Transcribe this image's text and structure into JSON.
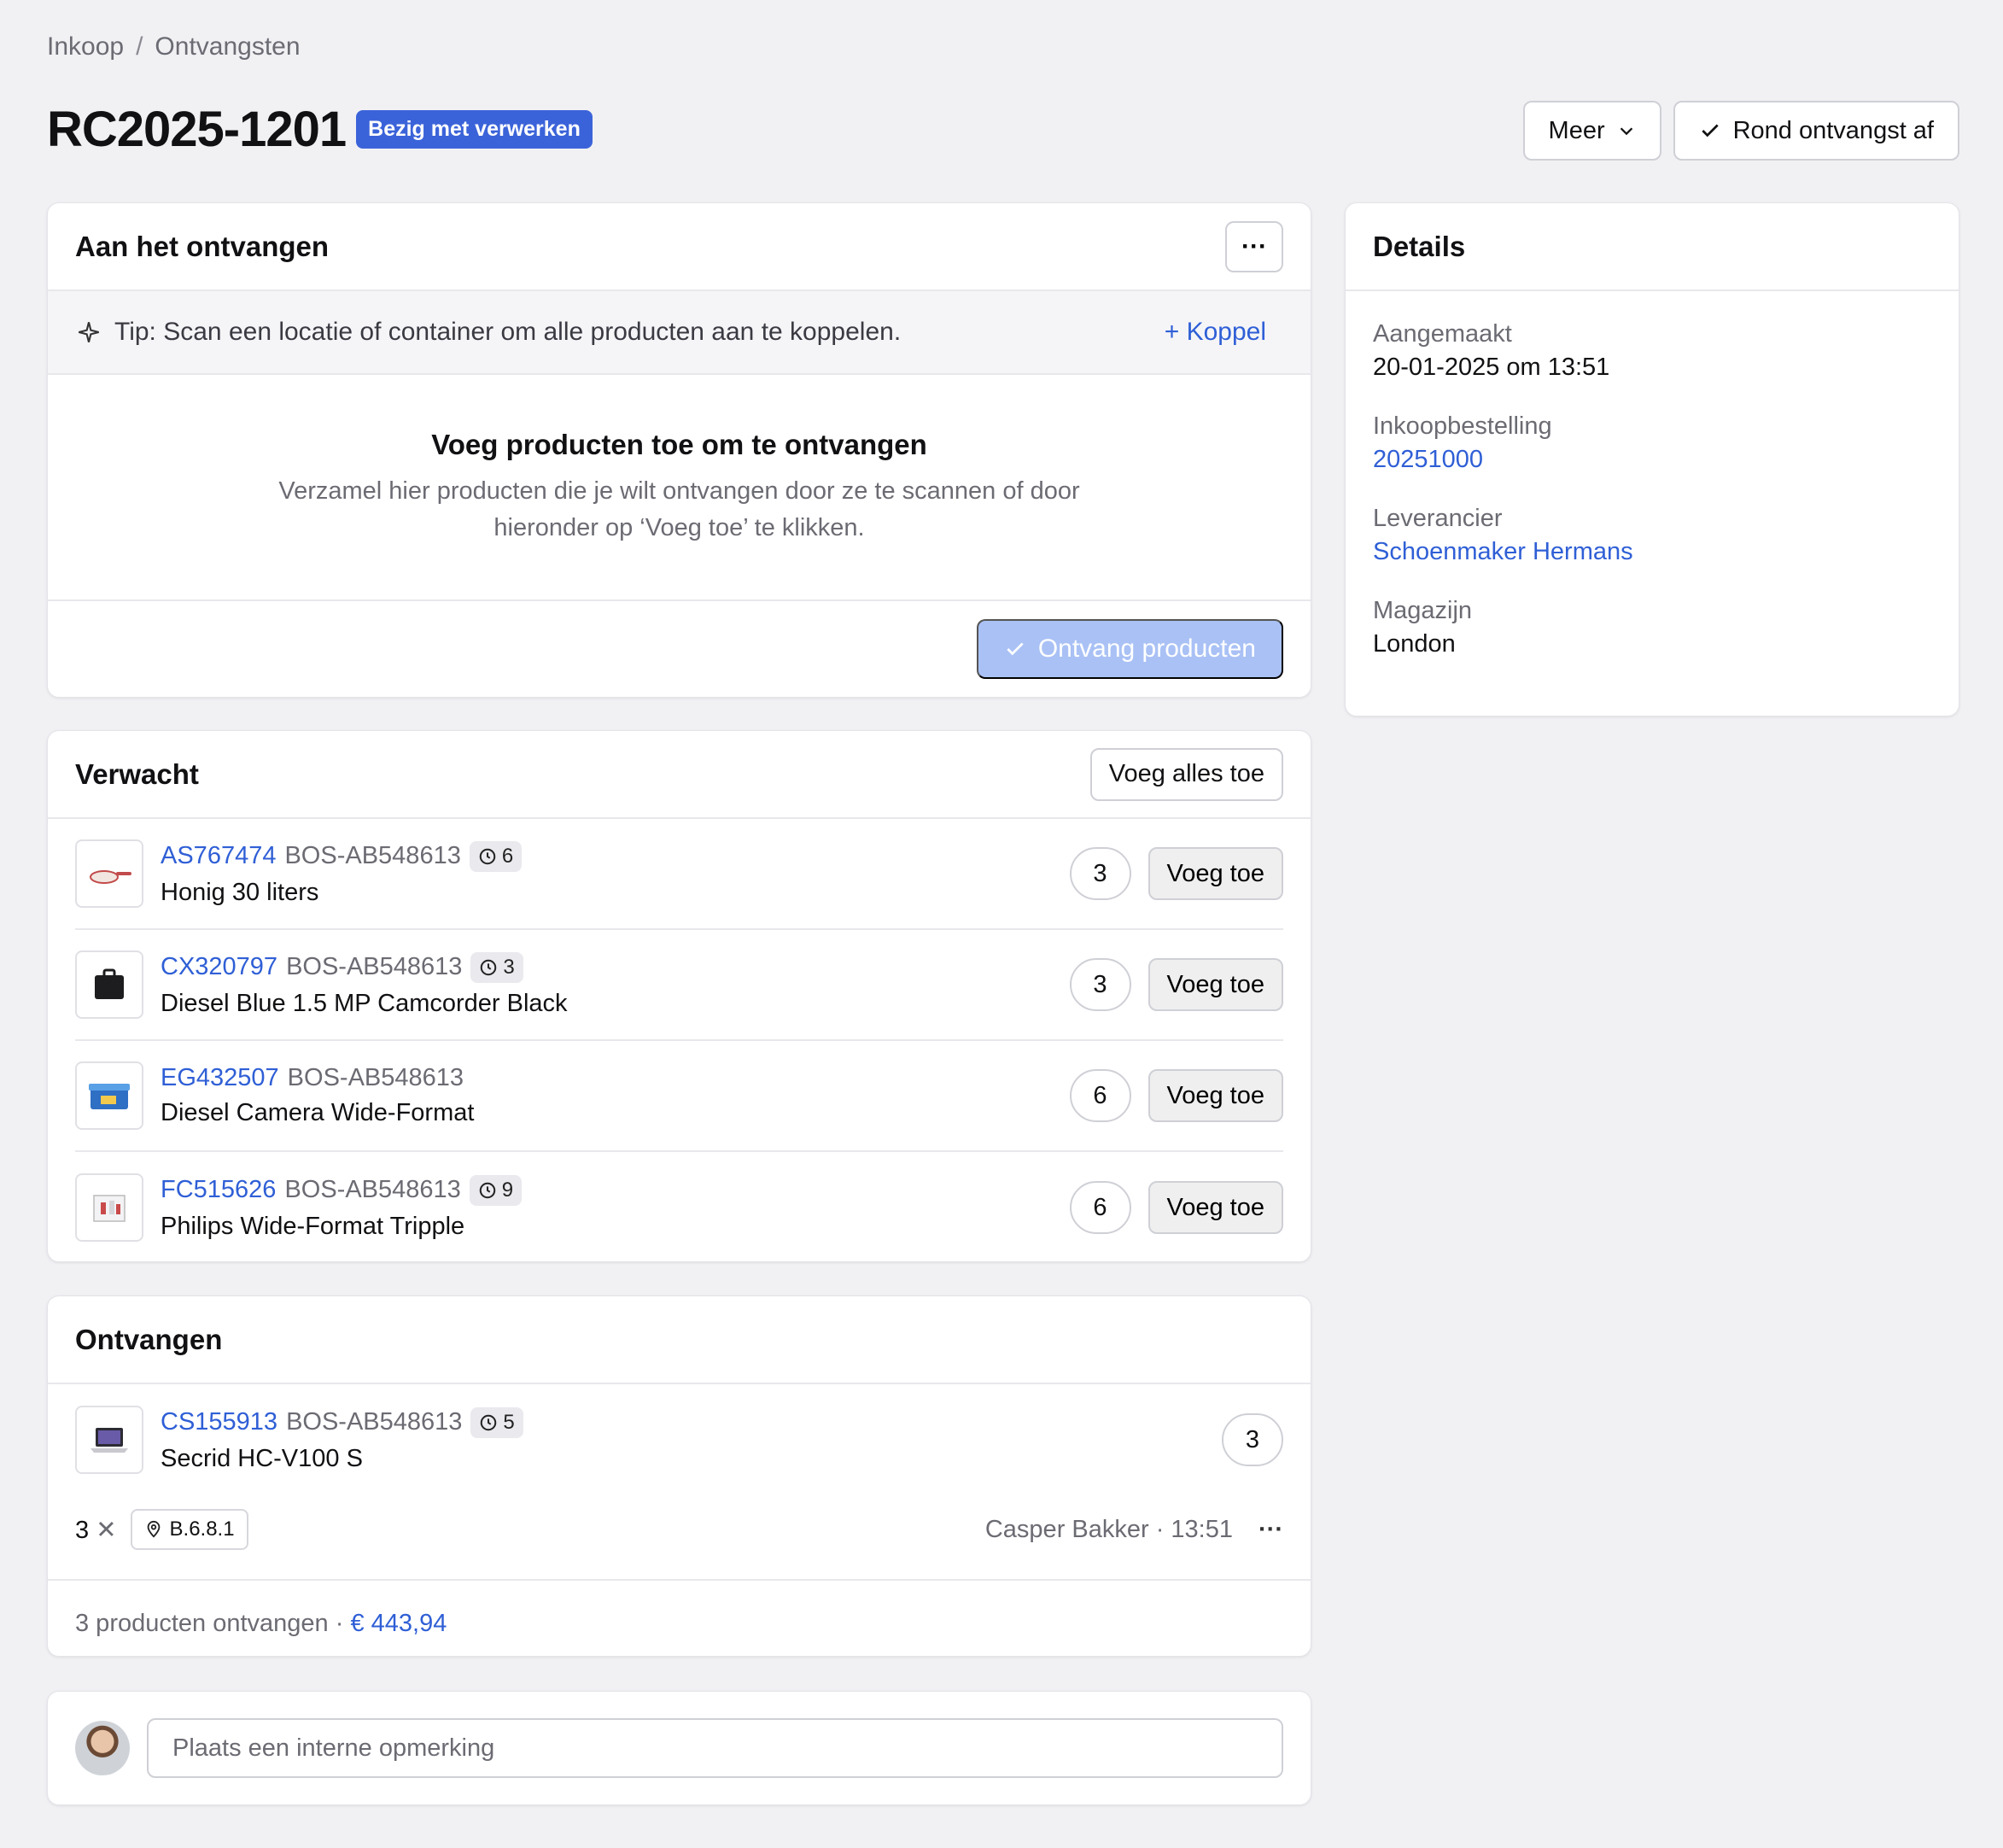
{
  "breadcrumb": {
    "items": [
      "Inkoop",
      "Ontvangsten"
    ],
    "separator": "/"
  },
  "header": {
    "title": "RC2025-1201",
    "status_badge": "Bezig met verwerken",
    "more_label": "Meer",
    "complete_label": "Rond ontvangst af"
  },
  "receiving": {
    "title": "Aan het ontvangen",
    "tip_text": "Tip: Scan een locatie of container om alle producten aan te koppelen.",
    "link_label": "+ Koppel",
    "empty_title": "Voeg producten toe om te ontvangen",
    "empty_desc": "Verzamel hier producten die je wilt ontvangen door ze te scannen of door hieronder op ‘Voeg toe’ te klikken.",
    "receive_button": "Ontvang producten"
  },
  "expected": {
    "title": "Verwacht",
    "add_all_label": "Voeg alles toe",
    "add_label": "Voeg toe",
    "items": [
      {
        "sku": "AS767474",
        "ref": "BOS-AB548613",
        "badge": "6",
        "name": "Honig 30 liters",
        "qty": "3"
      },
      {
        "sku": "CX320797",
        "ref": "BOS-AB548613",
        "badge": "3",
        "name": "Diesel Blue 1.5 MP Camcorder Black",
        "qty": "3"
      },
      {
        "sku": "EG432507",
        "ref": "BOS-AB548613",
        "badge": "",
        "name": "Diesel Camera Wide-Format",
        "qty": "6"
      },
      {
        "sku": "FC515626",
        "ref": "BOS-AB548613",
        "badge": "9",
        "name": "Philips Wide-Format Tripple",
        "qty": "6"
      }
    ]
  },
  "received": {
    "title": "Ontvangen",
    "item": {
      "sku": "CS155913",
      "ref": "BOS-AB548613",
      "badge": "5",
      "name": "Secrid HC-V100 S",
      "qty": "3"
    },
    "multiplier": "3",
    "location": "B.6.8.1",
    "by": "Casper Bakker · 13:51",
    "summary_text": "3 producten ontvangen ·",
    "summary_amount": "€ 443,94"
  },
  "comment": {
    "placeholder": "Plaats een interne opmerking"
  },
  "details": {
    "title": "Details",
    "created_label": "Aangemaakt",
    "created_value": "20-01-2025 om 13:51",
    "po_label": "Inkoopbestelling",
    "po_value": "20251000",
    "supplier_label": "Leverancier",
    "supplier_value": "Schoenmaker Hermans",
    "warehouse_label": "Magazijn",
    "warehouse_value": "London"
  },
  "colors": {
    "accent": "#2f5fd6",
    "badge": "#3b63d9",
    "primary_disabled": "#a9c1f5"
  }
}
